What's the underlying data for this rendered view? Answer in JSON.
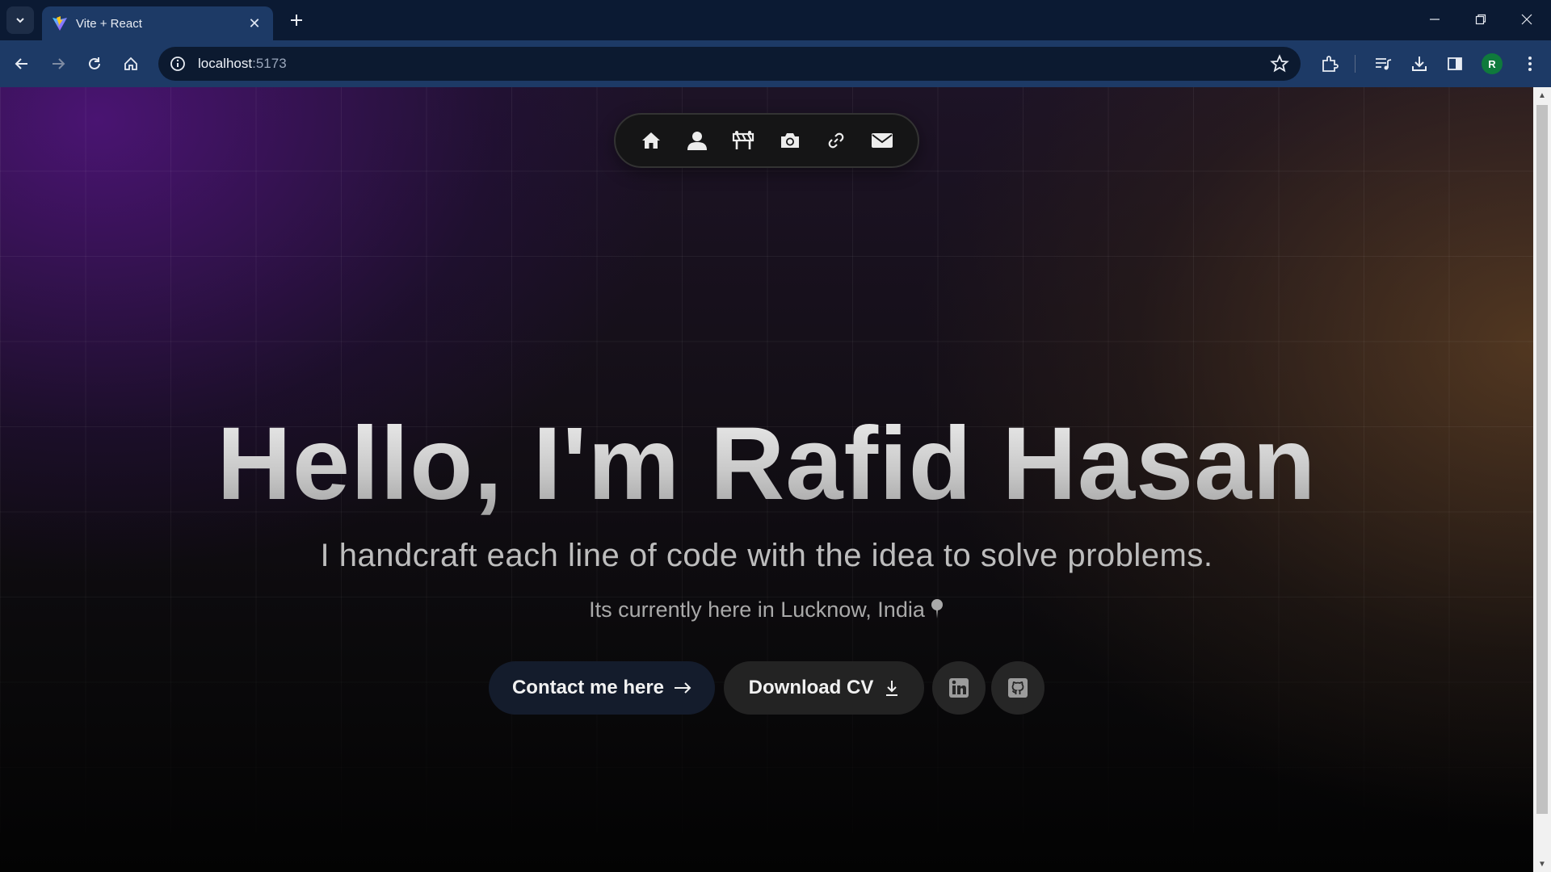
{
  "browser": {
    "tab_title": "Vite + React",
    "url_host": "localhost",
    "url_port": ":5173",
    "profile_initial": "R",
    "icons": [
      "tab-search-icon",
      "vite-favicon-icon",
      "close-icon",
      "plus-icon",
      "minimize-icon",
      "restore-icon",
      "close-window-icon",
      "back-icon",
      "forward-icon",
      "reload-icon",
      "home-icon",
      "site-info-icon",
      "star-icon",
      "extensions-icon",
      "media-icon",
      "download-icon",
      "side-panel-icon",
      "menu-icon"
    ]
  },
  "nav": {
    "icons": [
      "home-icon",
      "user-icon",
      "projects-icon",
      "camera-icon",
      "link-icon",
      "mail-icon"
    ]
  },
  "hero": {
    "title": "Hello, I'm Rafid Hasan",
    "subtitle": "I handcraft each line of code with the idea to solve problems.",
    "location": "Its currently  here in Lucknow, India"
  },
  "actions": {
    "contact_label": "Contact me here",
    "cv_label": "Download CV",
    "social_icons": [
      "linkedin-icon",
      "github-icon"
    ]
  },
  "colors": {
    "chrome_bg": "#0b1a33",
    "toolbar_bg": "#1d3a66",
    "page_purple": "#4c1476",
    "page_brown": "#5c3e22"
  }
}
